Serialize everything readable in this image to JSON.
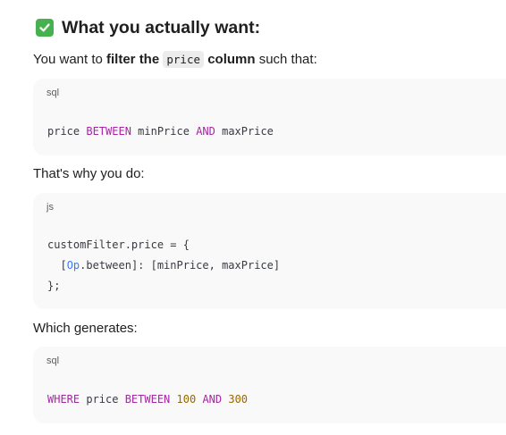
{
  "heading": {
    "icon": "check-mark-button-icon",
    "icon_color": "#46b14e",
    "text": "What you actually want:"
  },
  "intro": {
    "before": "You want to ",
    "bold1": "filter the",
    "code": "price",
    "bold2": "column",
    "after": " such that:"
  },
  "block1": {
    "lang": "sql",
    "tokens": {
      "t1": "price ",
      "t2": "BETWEEN",
      "t3": " minPrice ",
      "t4": "AND",
      "t5": " maxPrice"
    }
  },
  "para2": "That's why you do:",
  "block2": {
    "lang": "js",
    "line1": "customFilter.price = {",
    "line2": {
      "indent": "  [",
      "op": "Op",
      "rest": ".between]: [minPrice, maxPrice]"
    },
    "line3": "};"
  },
  "para3": "Which generates:",
  "block3": {
    "lang": "sql",
    "tokens": {
      "t1": "WHERE",
      "t2": " price ",
      "t3": "BETWEEN",
      "t4": " ",
      "t5": "100",
      "t6": " ",
      "t7": "AND",
      "t8": " ",
      "t9": "300"
    }
  },
  "colors": {
    "keyword": "#a626a4",
    "number": "#986801",
    "builtin": "#4078f2",
    "code_background": "#f9f9f9"
  }
}
